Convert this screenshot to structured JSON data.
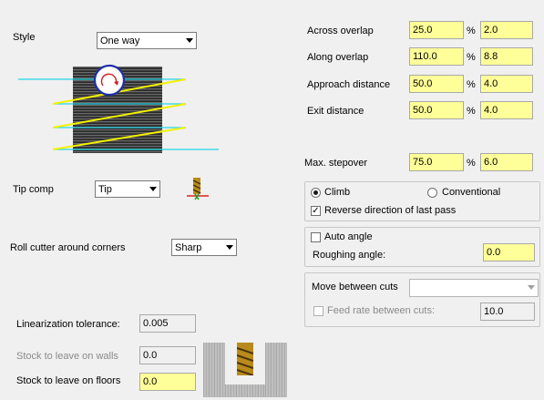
{
  "left": {
    "style": {
      "label": "Style",
      "value": "One way"
    },
    "tip_comp": {
      "label": "Tip comp",
      "value": "Tip"
    },
    "roll_cutter": {
      "label": "Roll cutter around corners",
      "value": "Sharp"
    },
    "linearization": {
      "label": "Linearization tolerance:",
      "value": "0.005"
    },
    "stock_walls": {
      "label": "Stock to leave on walls",
      "value": "0.0"
    },
    "stock_floors": {
      "label": "Stock to leave on floors",
      "value": "0.0"
    }
  },
  "right": {
    "across_overlap": {
      "label": "Across overlap",
      "pct": "25.0",
      "sym": "%",
      "val": "2.0"
    },
    "along_overlap": {
      "label": "Along overlap",
      "pct": "110.0",
      "sym": "%",
      "val": "8.8"
    },
    "approach_distance": {
      "label": "Approach distance",
      "pct": "50.0",
      "sym": "%",
      "val": "4.0"
    },
    "exit_distance": {
      "label": "Exit distance",
      "pct": "50.0",
      "sym": "%",
      "val": "4.0"
    },
    "max_stepover": {
      "label": "Max. stepover",
      "pct": "75.0",
      "sym": "%",
      "val": "6.0"
    },
    "direction": {
      "climb": "Climb",
      "conventional": "Conventional",
      "selected": "Climb"
    },
    "reverse_last_pass": {
      "label": "Reverse direction of last pass",
      "checked": true
    },
    "auto_angle": {
      "label": "Auto angle",
      "checked": false
    },
    "roughing_angle": {
      "label": "Roughing angle:",
      "value": "0.0"
    },
    "move_between_cuts": {
      "label": "Move between cuts",
      "value": ""
    },
    "feed_rate": {
      "label": "Feed rate between cuts:",
      "value": "10.0",
      "checked": false
    }
  },
  "colors": {
    "input_highlight": "#ffff99",
    "toolpath_yellow": "#f2f200",
    "toolpath_cyan": "#22d6e6"
  },
  "icons": [
    "tool-tip-icon",
    "tool-cross-section-icon",
    "cut-pattern-preview"
  ]
}
